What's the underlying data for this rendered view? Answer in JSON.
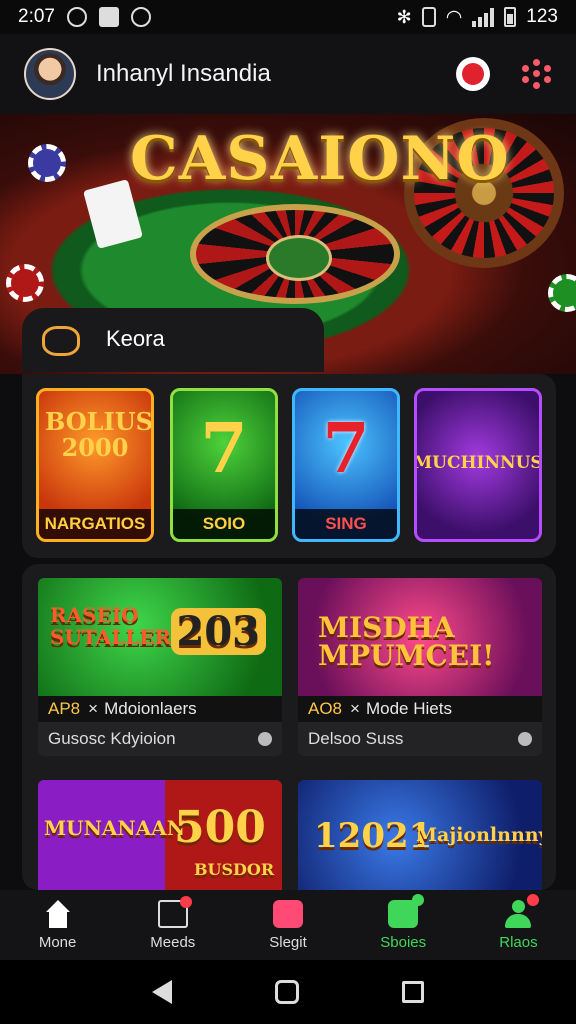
{
  "status_bar": {
    "time": "2:07",
    "battery": "123"
  },
  "header": {
    "user_name": "Inhanyl Insandia"
  },
  "hero": {
    "title": "CASAIONO",
    "section_label": "Keora"
  },
  "featured": [
    {
      "main": "BOLIUS 2000",
      "caption": "NARGATIOS",
      "bg": "#d2470f",
      "border": "#ffb020"
    },
    {
      "main": "7",
      "caption": "SOIO",
      "bg": "#1e8f22",
      "border": "#8fe040"
    },
    {
      "main": "7",
      "caption": "SING",
      "bg": "#1f7ad8",
      "border": "#3fb8ff"
    },
    {
      "main": "MUCHINNUS",
      "caption": "",
      "bg": "#5b1d91",
      "border": "#b64cff"
    }
  ],
  "cards": [
    {
      "art_text": "RASEIO SUTALLER",
      "art_num": "203",
      "tag": "AP8",
      "meta": "Mdoionlaers",
      "sub": "Gusosc Kdyioion"
    },
    {
      "art_text": "MISDHA MPUMCEI!",
      "art_num": "",
      "tag": "AO8",
      "meta": "Mode Hiets",
      "sub": "Delsoo Suss"
    },
    {
      "art_text": "MUNANAAN",
      "art_num": "500",
      "art_num_sub": "BUSDOR",
      "tag": "",
      "meta": "",
      "sub": ""
    },
    {
      "art_text": "Majionlnnnys",
      "art_num": "12021",
      "tag": "",
      "meta": "",
      "sub": ""
    }
  ],
  "tabs": [
    {
      "label": "Mone",
      "color": "#ffffff"
    },
    {
      "label": "Meeds",
      "color": "#e0e0e0"
    },
    {
      "label": "Slegit",
      "color": "#ff4a75"
    },
    {
      "label": "Sboies",
      "color": "#3fd65a"
    },
    {
      "label": "Rlaos",
      "color": "#3fd65a"
    }
  ]
}
